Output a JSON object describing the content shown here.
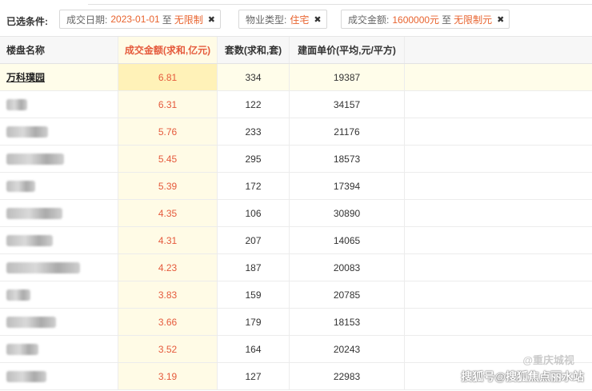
{
  "filters": {
    "label": "已选条件:",
    "chips": [
      {
        "key": "成交日期:",
        "value": "2023-01-01",
        "sep": "至",
        "value2": "无限制"
      },
      {
        "key": "物业类型:",
        "value": "住宅",
        "sep": "",
        "value2": ""
      },
      {
        "key": "成交金额:",
        "value": "1600000元",
        "sep": "至",
        "value2": "无限制元"
      }
    ]
  },
  "table": {
    "headers": [
      "楼盘名称",
      "成交金额(求和,亿元)",
      "套数(求和,套)",
      "建面单价(平均,元/平方)"
    ],
    "rows": [
      {
        "name": "万科璞园",
        "amount": "6.81",
        "units": "334",
        "price": "19387"
      },
      {
        "name": "",
        "amount": "6.31",
        "units": "122",
        "price": "34157"
      },
      {
        "name": "",
        "amount": "5.76",
        "units": "233",
        "price": "21176"
      },
      {
        "name": "",
        "amount": "5.45",
        "units": "295",
        "price": "18573"
      },
      {
        "name": "",
        "amount": "5.39",
        "units": "172",
        "price": "17394"
      },
      {
        "name": "",
        "amount": "4.35",
        "units": "106",
        "price": "30890"
      },
      {
        "name": "",
        "amount": "4.31",
        "units": "207",
        "price": "14065"
      },
      {
        "name": "",
        "amount": "4.23",
        "units": "187",
        "price": "20083"
      },
      {
        "name": "",
        "amount": "3.83",
        "units": "159",
        "price": "20785"
      },
      {
        "name": "",
        "amount": "3.66",
        "units": "179",
        "price": "18153"
      },
      {
        "name": "",
        "amount": "3.52",
        "units": "164",
        "price": "20243"
      },
      {
        "name": "",
        "amount": "3.19",
        "units": "127",
        "price": "22983"
      }
    ]
  },
  "watermark": {
    "faint": "@重庆城视",
    "main": "搜狐号@搜狐焦点丽水站"
  }
}
